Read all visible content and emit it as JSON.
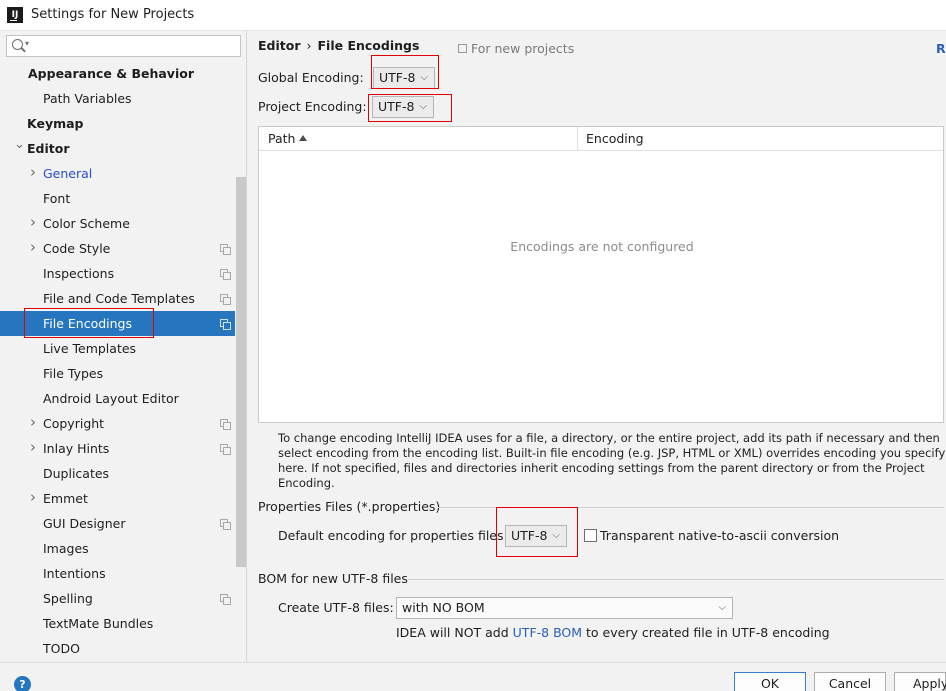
{
  "window": {
    "title": "Settings for New Projects",
    "app_icon": "IJ"
  },
  "sidebar": {
    "search_placeholder": "",
    "items": [
      {
        "label": "Appearance & Behavior",
        "bold": true,
        "arrow": "",
        "copy": false
      },
      {
        "label": "Path Variables",
        "bold": false,
        "arrow": "",
        "copy": false
      },
      {
        "label": "Keymap",
        "bold": true,
        "arrow": "",
        "copy": false
      },
      {
        "label": "Editor",
        "bold": true,
        "arrow": "expanded",
        "copy": false
      },
      {
        "label": "General",
        "bold": false,
        "arrow": "collapsed",
        "copy": false
      },
      {
        "label": "Font",
        "bold": false,
        "arrow": "",
        "copy": false
      },
      {
        "label": "Color Scheme",
        "bold": false,
        "arrow": "collapsed",
        "copy": false
      },
      {
        "label": "Code Style",
        "bold": false,
        "arrow": "collapsed",
        "copy": true
      },
      {
        "label": "Inspections",
        "bold": false,
        "arrow": "",
        "copy": true
      },
      {
        "label": "File and Code Templates",
        "bold": false,
        "arrow": "",
        "copy": true
      },
      {
        "label": "File Encodings",
        "bold": false,
        "arrow": "",
        "copy": true,
        "selected": true
      },
      {
        "label": "Live Templates",
        "bold": false,
        "arrow": "",
        "copy": false
      },
      {
        "label": "File Types",
        "bold": false,
        "arrow": "",
        "copy": false
      },
      {
        "label": "Android Layout Editor",
        "bold": false,
        "arrow": "",
        "copy": false
      },
      {
        "label": "Copyright",
        "bold": false,
        "arrow": "collapsed",
        "copy": true
      },
      {
        "label": "Inlay Hints",
        "bold": false,
        "arrow": "collapsed",
        "copy": true
      },
      {
        "label": "Duplicates",
        "bold": false,
        "arrow": "",
        "copy": false
      },
      {
        "label": "Emmet",
        "bold": false,
        "arrow": "collapsed",
        "copy": false
      },
      {
        "label": "GUI Designer",
        "bold": false,
        "arrow": "",
        "copy": true
      },
      {
        "label": "Images",
        "bold": false,
        "arrow": "",
        "copy": false
      },
      {
        "label": "Intentions",
        "bold": false,
        "arrow": "",
        "copy": false
      },
      {
        "label": "Spelling",
        "bold": false,
        "arrow": "",
        "copy": true
      },
      {
        "label": "TextMate Bundles",
        "bold": false,
        "arrow": "",
        "copy": false
      },
      {
        "label": "TODO",
        "bold": false,
        "arrow": "",
        "copy": false
      }
    ]
  },
  "main": {
    "breadcrumb": {
      "parent": "Editor",
      "separator": "›",
      "current": "File Encodings"
    },
    "for_new_projects": "For new projects",
    "reset_link": "Re",
    "global_encoding": {
      "label": "Global Encoding:",
      "value": "UTF-8"
    },
    "project_encoding": {
      "label": "Project Encoding:",
      "value": "UTF-8"
    },
    "table": {
      "columns": [
        "Path",
        "Encoding"
      ],
      "empty_text": "Encodings are not configured"
    },
    "help_text": "To change encoding IntelliJ IDEA uses for a file, a directory, or the entire project, add its path if necessary and then select encoding from the encoding list. Built-in file encoding (e.g. JSP, HTML or XML) overrides encoding you specify here. If not specified, files and directories inherit encoding settings from the parent directory or from the Project Encoding.",
    "properties_section": {
      "title": "Properties Files (*.properties)",
      "default_label": "Default encoding for properties files:",
      "default_value": "UTF-8",
      "transparent_label": "Transparent native-to-ascii conversion",
      "transparent_checked": false
    },
    "bom_section": {
      "title": "BOM for new UTF-8 files",
      "create_label": "Create UTF-8 files:",
      "create_value": "with NO BOM",
      "note_before": "IDEA will NOT add ",
      "note_link": "UTF-8 BOM",
      "note_after": " to every created file in UTF-8 encoding"
    }
  },
  "footer": {
    "help_icon": "?",
    "ok": "OK",
    "cancel": "Cancel",
    "apply": "Apply"
  },
  "colors": {
    "selection": "#2675bf",
    "highlight_box": "#e00000",
    "link": "#2a5fb5"
  }
}
